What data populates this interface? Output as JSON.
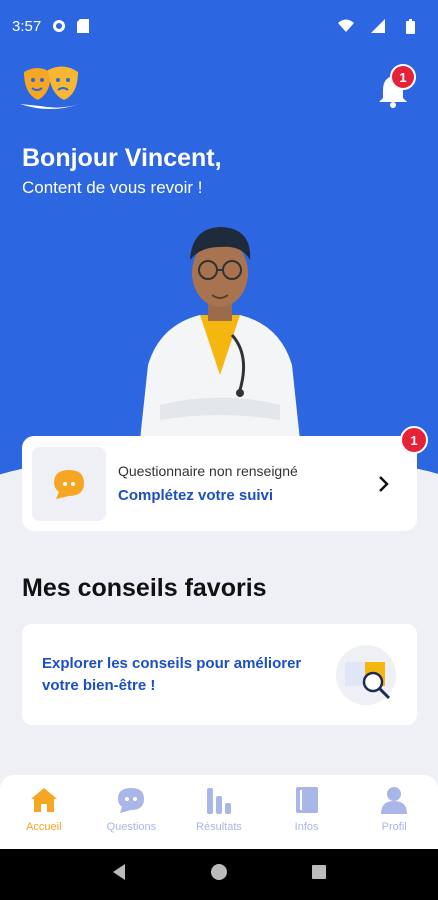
{
  "status_bar": {
    "time": "3:57"
  },
  "header": {
    "notification_count": "1"
  },
  "greeting": {
    "title": "Bonjour Vincent,",
    "subtitle": "Content de vous revoir !"
  },
  "questionnaire": {
    "title": "Questionnaire non renseigné",
    "action": "Complétez votre suivi",
    "badge": "1"
  },
  "favorites": {
    "section_title": "Mes conseils favoris",
    "card_text": "Explorer les conseils pour améliorer votre bien-être !"
  },
  "tabbar": {
    "items": [
      {
        "label": "Accueil",
        "icon": "home-icon",
        "active": true
      },
      {
        "label": "Questions",
        "icon": "chat-icon",
        "active": false
      },
      {
        "label": "Résultats",
        "icon": "bar-chart-icon",
        "active": false
      },
      {
        "label": "Infos",
        "icon": "book-icon",
        "active": false
      },
      {
        "label": "Profil",
        "icon": "user-icon",
        "active": false
      }
    ]
  },
  "colors": {
    "primary": "#2c66e0",
    "accent": "#f5a623",
    "badge": "#e6213a",
    "link": "#1d4fc4"
  }
}
